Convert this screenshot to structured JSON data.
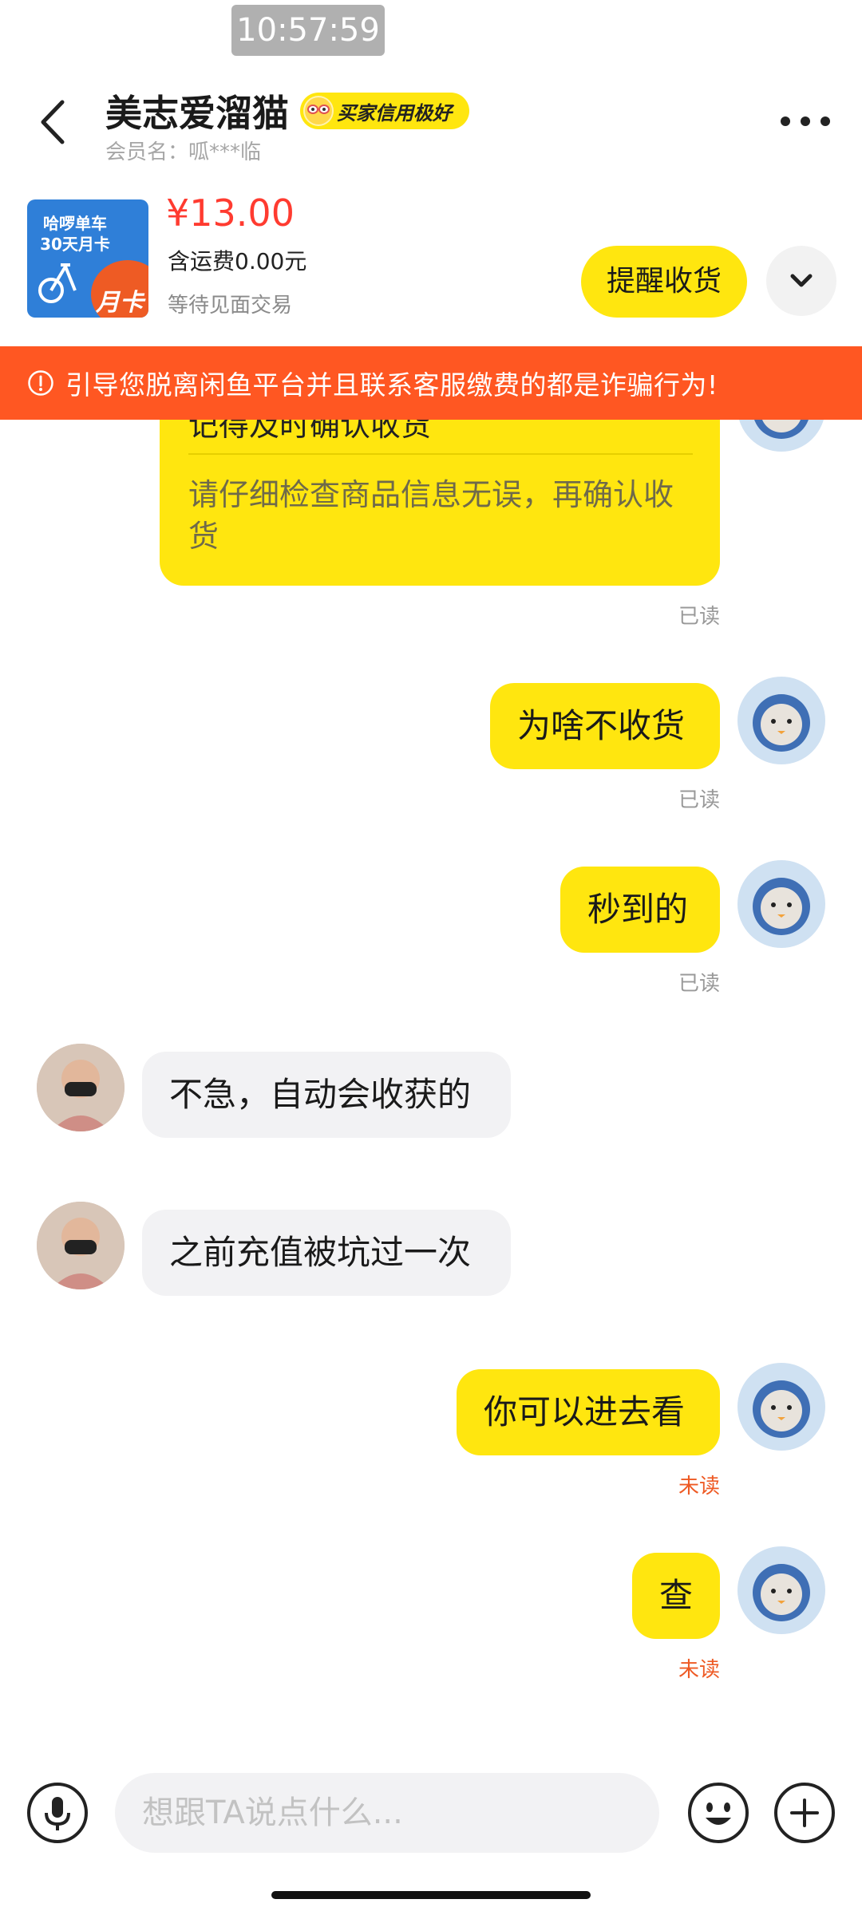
{
  "status_bar": {
    "time": "10:57:59"
  },
  "header": {
    "seller_name": "美志爱溜猫",
    "credit_badge": "买家信用极好",
    "member_label": "会员名：呱***临"
  },
  "product": {
    "thumb_line1": "哈啰单车",
    "thumb_line2": "30天月卡",
    "thumb_tag": "月卡",
    "price": "¥13.00",
    "shipping": "含运费0.00元",
    "status": "等待见面交易",
    "remind_button": "提醒收货"
  },
  "warning": {
    "text": "引导您脱离闲鱼平台并且联系客服缴费的都是诈骗行为!"
  },
  "chat": {
    "system_card": {
      "title": "记得及时确认收货",
      "body": "请仔细检查商品信息无误，再确认收货",
      "status": "已读"
    },
    "messages": [
      {
        "text": "为啥不收货",
        "status": "已读"
      },
      {
        "text": "秒到的",
        "status": "已读"
      },
      {
        "text": "不急，自动会收获的"
      },
      {
        "text": "之前充值被坑过一次"
      },
      {
        "text": "你可以进去看",
        "status": "未读"
      },
      {
        "text": "查",
        "status": "未读"
      }
    ]
  },
  "input_bar": {
    "placeholder": "想跟TA说点什么..."
  },
  "icons": {
    "back": "back-arrow-icon",
    "more": "more-dots-icon",
    "expand": "chevron-down-icon",
    "warning": "alert-circle-icon",
    "mic": "microphone-icon",
    "emoji": "emoji-icon",
    "plus": "plus-icon"
  },
  "colors": {
    "accent_yellow": "#ffe60f",
    "warning_orange": "#ff5722",
    "price_red": "#ff3b30",
    "unread_orange": "#ee5a24"
  }
}
